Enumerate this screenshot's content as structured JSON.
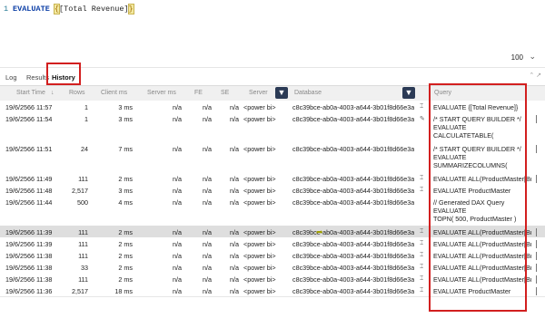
{
  "editor": {
    "line_number": "1",
    "keyword": "EVALUATE",
    "open_brace": "{",
    "measure": "[Total Revenue]",
    "close_brace": "}"
  },
  "zoom": {
    "value": "100"
  },
  "tabs": [
    {
      "label": "Log"
    },
    {
      "label": "Results"
    },
    {
      "label": "History"
    }
  ],
  "columns": [
    {
      "label": "Start Time"
    },
    {
      "label": "Rows"
    },
    {
      "label": "Client ms"
    },
    {
      "label": "Server ms"
    },
    {
      "label": "FE"
    },
    {
      "label": "SE"
    },
    {
      "label": "Server"
    },
    {
      "label": "Database"
    },
    {
      "label": "Query"
    }
  ],
  "rows": [
    {
      "start": "19/6/2566 11:57",
      "rows": "1",
      "client": "3 ms",
      "server_ms": "n/a",
      "fe": "n/a",
      "se": "n/a",
      "server": "<power bi>",
      "db": "c8c39bce-ab0a-4003-a644-3b01f8d66e3a",
      "query": "EVALUATE {[Total Revenue]}"
    },
    {
      "start": "19/6/2566 11:54",
      "rows": "1",
      "client": "3 ms",
      "server_ms": "n/a",
      "fe": "n/a",
      "se": "n/a",
      "server": "<power bi>",
      "db": "c8c39bce-ab0a-4003-a644-3b01f8d66e3a",
      "query": "/* START QUERY BUILDER */\nEVALUATE\nCALCULATETABLE(\n    ROW("
    },
    {
      "start": "19/6/2566 11:51",
      "rows": "24",
      "client": "7 ms",
      "server_ms": "n/a",
      "fe": "n/a",
      "se": "n/a",
      "server": "<power bi>",
      "db": "c8c39bce-ab0a-4003-a644-3b01f8d66e3a",
      "query": "/* START QUERY BUILDER */\nEVALUATE\nSUMMARIZECOLUMNS(\n    ProductMaster[Category"
    },
    {
      "start": "19/6/2566 11:49",
      "rows": "111",
      "client": "2 ms",
      "server_ms": "n/a",
      "fe": "n/a",
      "se": "n/a",
      "server": "<power bi>",
      "db": "c8c39bce-ab0a-4003-a644-3b01f8d66e3a",
      "query": "EVALUATE ALL(ProductMaster[Bra"
    },
    {
      "start": "19/6/2566 11:48",
      "rows": "2,517",
      "client": "3 ms",
      "server_ms": "n/a",
      "fe": "n/a",
      "se": "n/a",
      "server": "<power bi>",
      "db": "c8c39bce-ab0a-4003-a644-3b01f8d66e3a",
      "query": "EVALUATE ProductMaster"
    },
    {
      "start": "19/6/2566 11:44",
      "rows": "500",
      "client": "4 ms",
      "server_ms": "n/a",
      "fe": "n/a",
      "se": "n/a",
      "server": "<power bi>",
      "db": "c8c39bce-ab0a-4003-a644-3b01f8d66e3a",
      "query": "// Generated DAX Query\nEVALUATE\nTOPN( 500, ProductMaster )"
    },
    {
      "start": "19/6/2566 11:39",
      "rows": "111",
      "client": "2 ms",
      "server_ms": "n/a",
      "fe": "n/a",
      "se": "n/a",
      "server": "<power bi>",
      "db": "c8c39bce-ab0a-4003-a644-3b01f8d66e3a",
      "query": "EVALUATE ALL(ProductMaster[Bra"
    },
    {
      "start": "19/6/2566 11:39",
      "rows": "111",
      "client": "2 ms",
      "server_ms": "n/a",
      "fe": "n/a",
      "se": "n/a",
      "server": "<power bi>",
      "db": "c8c39bce-ab0a-4003-a644-3b01f8d66e3a",
      "query": "EVALUATE ALL(ProductMaster[Bra"
    },
    {
      "start": "19/6/2566 11:38",
      "rows": "111",
      "client": "2 ms",
      "server_ms": "n/a",
      "fe": "n/a",
      "se": "n/a",
      "server": "<power bi>",
      "db": "c8c39bce-ab0a-4003-a644-3b01f8d66e3a",
      "query": "EVALUATE ALL(ProductMaster[Bra"
    },
    {
      "start": "19/6/2566 11:38",
      "rows": "33",
      "client": "2 ms",
      "server_ms": "n/a",
      "fe": "n/a",
      "se": "n/a",
      "server": "<power bi>",
      "db": "c8c39bce-ab0a-4003-a644-3b01f8d66e3a",
      "query": "EVALUATE ALL(ProductMaster[Bra"
    },
    {
      "start": "19/6/2566 11:38",
      "rows": "111",
      "client": "2 ms",
      "server_ms": "n/a",
      "fe": "n/a",
      "se": "n/a",
      "server": "<power bi>",
      "db": "c8c39bce-ab0a-4003-a644-3b01f8d66e3a",
      "query": "EVALUATE ALL(ProductMaster[Bra"
    },
    {
      "start": "19/6/2566 11:36",
      "rows": "2,517",
      "client": "18 ms",
      "server_ms": "n/a",
      "fe": "n/a",
      "se": "n/a",
      "server": "<power bi>",
      "db": "c8c39bce-ab0a-4003-a644-3b01f8d66e3a",
      "query": "EVALUATE ProductMaster"
    }
  ]
}
